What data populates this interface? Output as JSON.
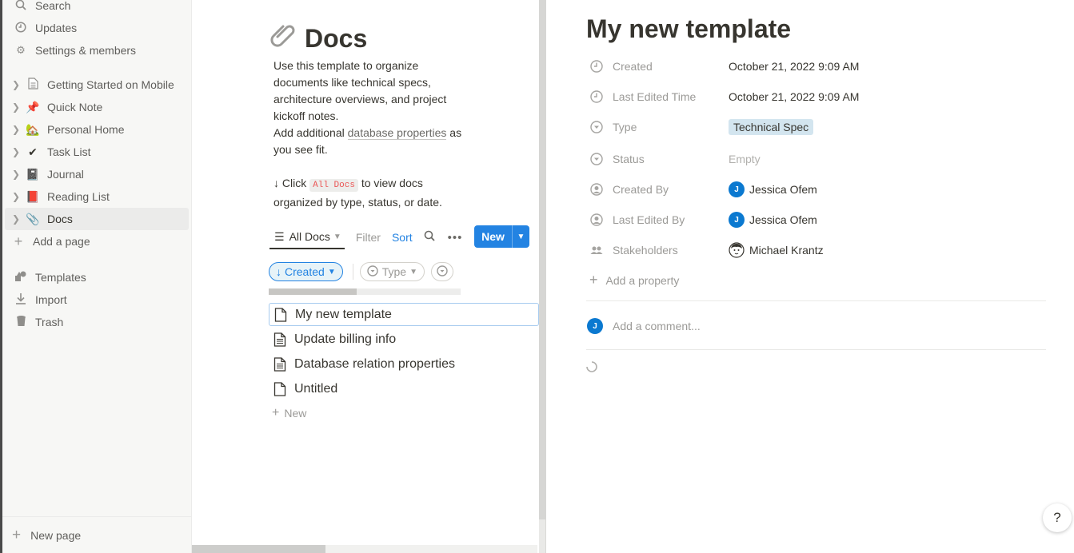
{
  "sidebar": {
    "top_items": [
      {
        "label": "Search",
        "icon": "search-icon"
      },
      {
        "label": "Updates",
        "icon": "clock-icon"
      },
      {
        "label": "Settings & members",
        "icon": "gear-icon"
      }
    ],
    "pages": [
      {
        "label": "Getting Started on Mobile",
        "emoji": "📄"
      },
      {
        "label": "Quick Note",
        "emoji": "📌"
      },
      {
        "label": "Personal Home",
        "emoji": "🏡"
      },
      {
        "label": "Task List",
        "emoji": "✔"
      },
      {
        "label": "Journal",
        "emoji": "📓"
      },
      {
        "label": "Reading List",
        "emoji": "📕"
      },
      {
        "label": "Docs",
        "emoji": "📎"
      }
    ],
    "add_page": "Add a page",
    "utility_items": [
      {
        "label": "Templates",
        "icon": "shapes-icon"
      },
      {
        "label": "Import",
        "icon": "download-icon"
      },
      {
        "label": "Trash",
        "icon": "trash-icon"
      }
    ],
    "new_page": "New page"
  },
  "doc": {
    "title": "Docs",
    "description_lines": [
      "Use this template to organize documents like technical specs, architecture overviews, and project kickoff notes."
    ],
    "additional_prefix": "Add additional ",
    "additional_link": "database properties",
    "additional_suffix": " as you see fit.",
    "click_prefix": "↓ Click ",
    "click_code": "All Docs",
    "click_suffix": " to view docs organized by type, status, or date.",
    "view_tab": "All Docs",
    "filter": "Filter",
    "sort": "Sort",
    "new_button": "New",
    "chips": {
      "created": "Created",
      "type": "Type"
    },
    "rows": [
      "My new template",
      "Update billing info",
      "Database relation properties",
      "Untitled"
    ],
    "add_new": "New"
  },
  "peek": {
    "title": "My new template",
    "properties": [
      {
        "name": "Created",
        "value": "October 21, 2022 9:09 AM"
      },
      {
        "name": "Last Edited Time",
        "value": "October 21, 2022 9:09 AM"
      },
      {
        "name": "Type",
        "value": "Technical Spec"
      },
      {
        "name": "Status",
        "value": "Empty"
      },
      {
        "name": "Created By",
        "value": "Jessica Ofem"
      },
      {
        "name": "Last Edited By",
        "value": "Jessica Ofem"
      },
      {
        "name": "Stakeholders",
        "value": "Michael Krantz"
      }
    ],
    "avatar_initial": "J",
    "add_property": "Add a property",
    "comment_placeholder": "Add a comment...",
    "help": "?"
  }
}
